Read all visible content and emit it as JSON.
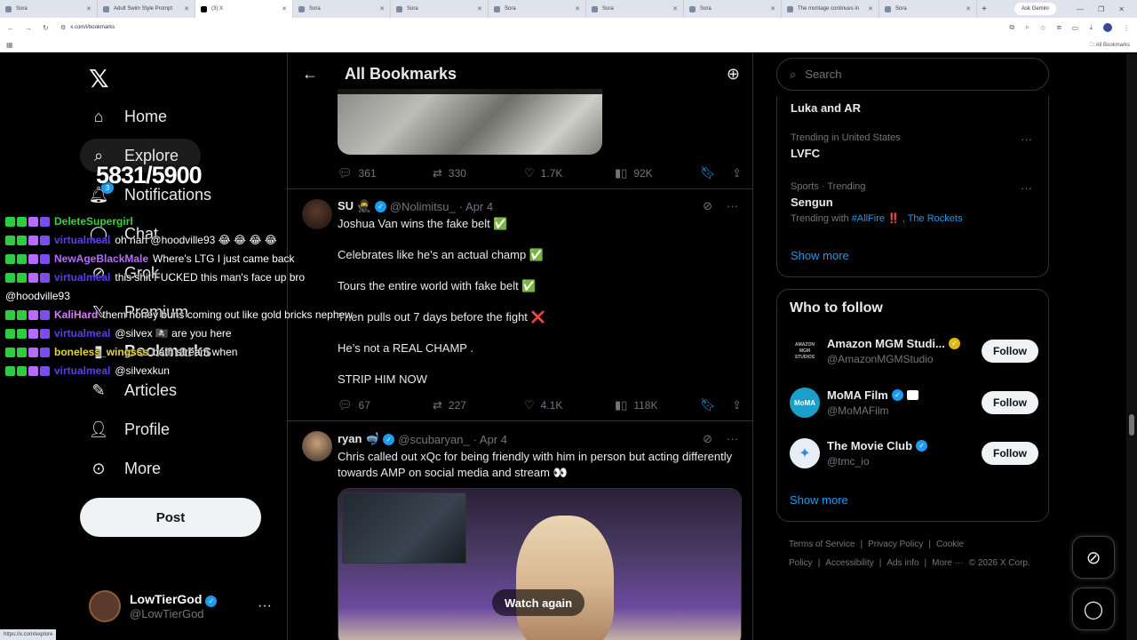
{
  "browser": {
    "tabs": [
      {
        "label": "Sora",
        "active": false
      },
      {
        "label": "Adult Swim Style Prompt",
        "active": false
      },
      {
        "label": "(3) X",
        "active": true
      },
      {
        "label": "Sora",
        "active": false
      },
      {
        "label": "Sora",
        "active": false
      },
      {
        "label": "Sora",
        "active": false
      },
      {
        "label": "Sora",
        "active": false
      },
      {
        "label": "Sora",
        "active": false
      },
      {
        "label": "The montage continues in",
        "active": false
      },
      {
        "label": "Sora",
        "active": false
      }
    ],
    "ask_gemini": "Ask Gemini",
    "url": "x.com/i/bookmarks",
    "all_bookmarks": "All Bookmarks",
    "status_url": "https://x.com/explore"
  },
  "nav": {
    "home": "Home",
    "explore": "Explore",
    "notifications": "Notifications",
    "notifications_badge": "3",
    "chat": "Chat",
    "grok": "Grok",
    "premium": "Premium",
    "bookmarks": "Bookmarks",
    "articles": "Articles",
    "profile": "Profile",
    "more": "More",
    "post": "Post"
  },
  "account": {
    "name": "LowTierGod",
    "handle": "@LowTierGod"
  },
  "overlay": {
    "counter": "5831/5900",
    "chat": [
      {
        "user": "DeleteSupergirl",
        "user_color": "#3ecf3e",
        "msg": ""
      },
      {
        "user": "virtualmeal",
        "user_color": "#5a3cf0",
        "msg": "oh nah @hoodville93 😂 😂 😂 😂"
      },
      {
        "user": "NewAgeBlackMale",
        "user_color": "#b46cff",
        "msg": "Where's LTG I just came back"
      },
      {
        "user": "virtualmeal",
        "user_color": "#5a3cf0",
        "msg": "this shit FUCKED this man's face up bro"
      },
      {
        "user": "",
        "user_color": "#ffffff",
        "msg": "@hoodville93"
      },
      {
        "user": "KaliHard",
        "user_color": "#d67cff",
        "msg": "them honey buns coming out like gold bricks nephew"
      },
      {
        "user": "virtualmeal",
        "user_color": "#5a3cf0",
        "msg": "@silvex 🏴‍☠️ are you here"
      },
      {
        "user": "boneless_wingsss",
        "user_color": "#e8d23a",
        "msg": "bath stream when"
      },
      {
        "user": "virtualmeal",
        "user_color": "#5a3cf0",
        "msg": "@silvexkun"
      }
    ]
  },
  "center": {
    "title": "All Bookmarks",
    "tweet0": {
      "replies": "361",
      "reposts": "330",
      "likes": "1.7K",
      "views": "92K"
    },
    "tweet1": {
      "name": "SU 🥷",
      "handle": "@Nolimitsu_",
      "date": "· Apr 4",
      "lines": [
        "Joshua Van wins the fake belt ✅",
        "Celebrates like he’s an actual champ ✅",
        "Tours the entire world with fake belt ✅",
        "Then pulls out 7 days before the fight ❌",
        "He’s not a REAL CHAMP .",
        "STRIP HIM NOW"
      ],
      "replies": "67",
      "reposts": "227",
      "likes": "4.1K",
      "views": "118K"
    },
    "tweet2": {
      "name": "ryan 🤿",
      "handle": "@scubaryan_",
      "date": "· Apr 4",
      "text": "Chris called out xQc for being friendly with him in person but acting differently towards AMP on social media and stream 👀",
      "watch_again": "Watch again"
    }
  },
  "right": {
    "search_placeholder": "Search",
    "trends": [
      {
        "ctx": "",
        "name": "Luka and AR",
        "with": ""
      },
      {
        "ctx": "Trending in United States",
        "name": "LVFC",
        "with": ""
      },
      {
        "ctx": "Sports · Trending",
        "name": "Sengun",
        "with_prefix": "Trending with",
        "with_tags": "#AllFire ‼️ , The Rockets"
      }
    ],
    "show_more": "Show more",
    "who_to_follow": "Who to follow",
    "follows": [
      {
        "name": "Amazon MGM Studi...",
        "handle": "@AmazonMGMStudio",
        "btn": "Follow",
        "avatar_text": "AMAZON MGM STUDIOS"
      },
      {
        "name": "MoMA Film",
        "handle": "@MoMAFilm",
        "btn": "Follow",
        "avatar_text": "MoMA"
      },
      {
        "name": "The Movie Club",
        "handle": "@tmc_io",
        "btn": "Follow",
        "avatar_text": ""
      }
    ],
    "show_more2": "Show more",
    "footer": [
      "Terms of Service",
      "|",
      "Privacy Policy",
      "|",
      "Cookie Policy",
      "|",
      "Accessibility",
      "|",
      "Ads info",
      "|",
      "More ···",
      "© 2026 X Corp."
    ]
  }
}
